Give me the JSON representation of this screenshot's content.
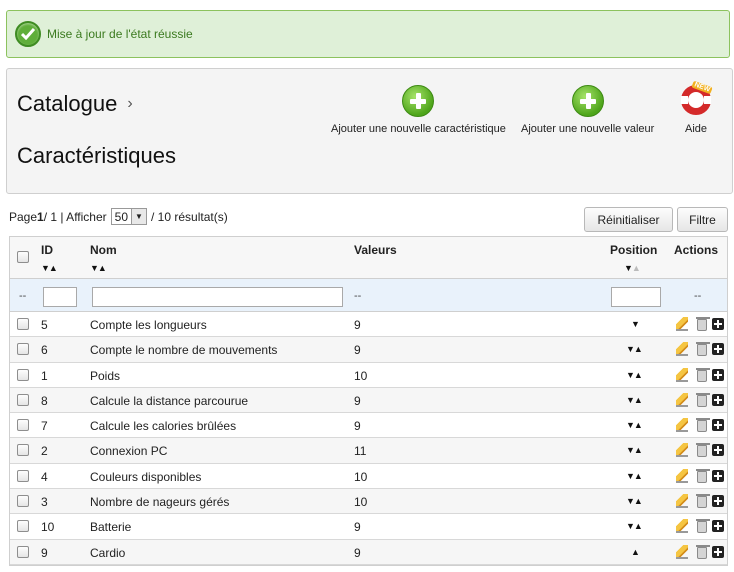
{
  "alert": {
    "text": "Mise à jour de l'état réussie"
  },
  "toolbar": {
    "breadcrumb": "Catalogue",
    "breadcrumb_sep": "›",
    "page_title": "Caractéristiques",
    "add_feature_label": "Ajouter une nouvelle caractéristique",
    "add_value_label": "Ajouter une nouvelle valeur",
    "help_label": "Aide",
    "help_badge": "NEW"
  },
  "pagination": {
    "prefix": "Page ",
    "page": "1",
    "of": " / 1 | Afficher ",
    "per_page": "50",
    "results": " / 10 résultat(s)"
  },
  "buttons": {
    "reset": "Réinitialiser",
    "filter": "Filtre"
  },
  "table": {
    "headers": {
      "id": "ID",
      "name": "Nom",
      "values": "Valeurs",
      "position": "Position",
      "actions": "Actions"
    },
    "filter_dash": "--",
    "rows": [
      {
        "id": "5",
        "name": "Compte les longueurs",
        "values": "9",
        "pos": "down"
      },
      {
        "id": "6",
        "name": "Compte le nombre de mouvements",
        "values": "9",
        "pos": "both"
      },
      {
        "id": "1",
        "name": "Poids",
        "values": "10",
        "pos": "both"
      },
      {
        "id": "8",
        "name": "Calcule la distance parcourue",
        "values": "9",
        "pos": "both"
      },
      {
        "id": "7",
        "name": "Calcule les calories brûlées",
        "values": "9",
        "pos": "both"
      },
      {
        "id": "2",
        "name": "Connexion PC",
        "values": "11",
        "pos": "both"
      },
      {
        "id": "4",
        "name": "Couleurs disponibles",
        "values": "10",
        "pos": "both"
      },
      {
        "id": "3",
        "name": "Nombre de nageurs gérés",
        "values": "10",
        "pos": "both"
      },
      {
        "id": "10",
        "name": "Batterie",
        "values": "9",
        "pos": "both"
      },
      {
        "id": "9",
        "name": "Cardio",
        "values": "9",
        "pos": "up"
      }
    ]
  },
  "icons": {
    "check": "check-icon",
    "add": "plus-circle-icon",
    "help": "lifebuoy-icon",
    "edit": "pencil-icon",
    "delete": "trash-icon",
    "details": "plus-box-icon"
  },
  "colors": {
    "success_bg": "#dff0d8",
    "success_border": "#8cc25e",
    "filter_row_bg": "#e9f2fb"
  }
}
